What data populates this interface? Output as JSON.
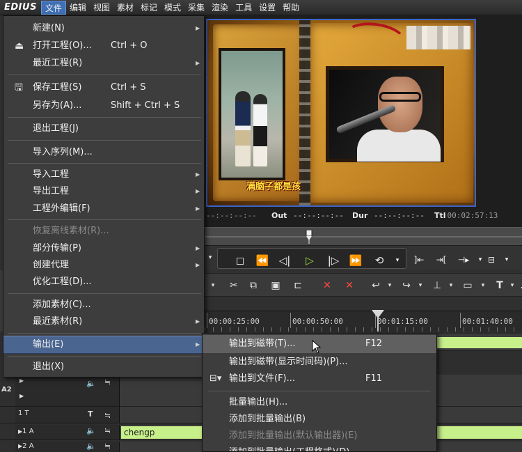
{
  "app": {
    "logo": "EDIUS"
  },
  "menubar": {
    "items": [
      {
        "label": "文件"
      },
      {
        "label": "编辑"
      },
      {
        "label": "视图"
      },
      {
        "label": "素材"
      },
      {
        "label": "标记"
      },
      {
        "label": "模式"
      },
      {
        "label": "采集"
      },
      {
        "label": "渲染"
      },
      {
        "label": "工具"
      },
      {
        "label": "设置"
      },
      {
        "label": "帮助"
      }
    ],
    "active_index": 0
  },
  "preview": {
    "caption": "满脑子都是孩",
    "timecodes": {
      "in_value": "--:--:--:--",
      "out_label": "Out",
      "out_value": "--:--:--:--",
      "dur_label": "Dur",
      "dur_value": "--:--:--:--",
      "ttl_label": "Ttl",
      "ttl_value": "00:02:57:13"
    }
  },
  "timeline": {
    "ruler": [
      "00:00:25:00",
      "00:00:50:00",
      "00:01:15:00",
      "00:01:40:00"
    ],
    "tracks": [
      {
        "side": "A2",
        "label": ""
      },
      {
        "side": "",
        "label": "1 T"
      },
      {
        "side": "",
        "label": "1 A",
        "clip": "chengp"
      },
      {
        "side": "",
        "label": "2 A"
      }
    ]
  },
  "file_menu": {
    "items": [
      {
        "label": "新建(N)",
        "shortcut": "",
        "submenu": true,
        "icon": "",
        "disabled": false
      },
      {
        "label": "打开工程(O)...",
        "shortcut": "Ctrl + O",
        "submenu": false,
        "icon": "open-project-icon",
        "disabled": false
      },
      {
        "label": "最近工程(R)",
        "shortcut": "",
        "submenu": true,
        "icon": "",
        "disabled": false
      },
      {
        "label": "保存工程(S)",
        "shortcut": "Ctrl + S",
        "submenu": false,
        "icon": "save-icon",
        "disabled": false
      },
      {
        "label": "另存为(A)...",
        "shortcut": "Shift + Ctrl + S",
        "submenu": false,
        "icon": "",
        "disabled": false
      },
      {
        "label": "退出工程(J)",
        "shortcut": "",
        "submenu": false,
        "icon": "",
        "disabled": false
      },
      {
        "label": "导入序列(M)...",
        "shortcut": "",
        "submenu": false,
        "icon": "",
        "disabled": false
      },
      {
        "label": "导入工程",
        "shortcut": "",
        "submenu": true,
        "icon": "",
        "disabled": false
      },
      {
        "label": "导出工程",
        "shortcut": "",
        "submenu": true,
        "icon": "",
        "disabled": false
      },
      {
        "label": "工程外编辑(F)",
        "shortcut": "",
        "submenu": true,
        "icon": "",
        "disabled": false
      },
      {
        "label": "恢复离线素材(R)...",
        "shortcut": "",
        "submenu": false,
        "icon": "",
        "disabled": true
      },
      {
        "label": "部分传输(P)",
        "shortcut": "",
        "submenu": true,
        "icon": "",
        "disabled": false
      },
      {
        "label": "创建代理",
        "shortcut": "",
        "submenu": true,
        "icon": "",
        "disabled": false
      },
      {
        "label": "优化工程(D)...",
        "shortcut": "",
        "submenu": false,
        "icon": "",
        "disabled": false
      },
      {
        "label": "添加素材(C)...",
        "shortcut": "",
        "submenu": false,
        "icon": "",
        "disabled": false
      },
      {
        "label": "最近素材(R)",
        "shortcut": "",
        "submenu": true,
        "icon": "",
        "disabled": false
      },
      {
        "label": "输出(E)",
        "shortcut": "",
        "submenu": true,
        "icon": "",
        "disabled": false,
        "active": true
      },
      {
        "label": "退出(X)",
        "shortcut": "",
        "submenu": false,
        "icon": "",
        "disabled": false
      }
    ]
  },
  "output_submenu": {
    "items": [
      {
        "label": "输出到磁带(T)...",
        "shortcut": "F12",
        "disabled": false,
        "active": true
      },
      {
        "label": "输出到磁带(显示时间码)(P)...",
        "shortcut": "",
        "disabled": false
      },
      {
        "label": "输出到文件(F)...",
        "shortcut": "F11",
        "disabled": false,
        "icon": "export-file-icon"
      },
      {
        "label": "批量输出(H)...",
        "shortcut": "",
        "disabled": false
      },
      {
        "label": "添加到批量输出(B)",
        "shortcut": "",
        "disabled": false
      },
      {
        "label": "添加到批量输出(默认输出器)(E)",
        "shortcut": "",
        "disabled": true
      },
      {
        "label": "添加到批量输出(工程格式)(D)",
        "shortcut": "",
        "disabled": false
      }
    ]
  }
}
